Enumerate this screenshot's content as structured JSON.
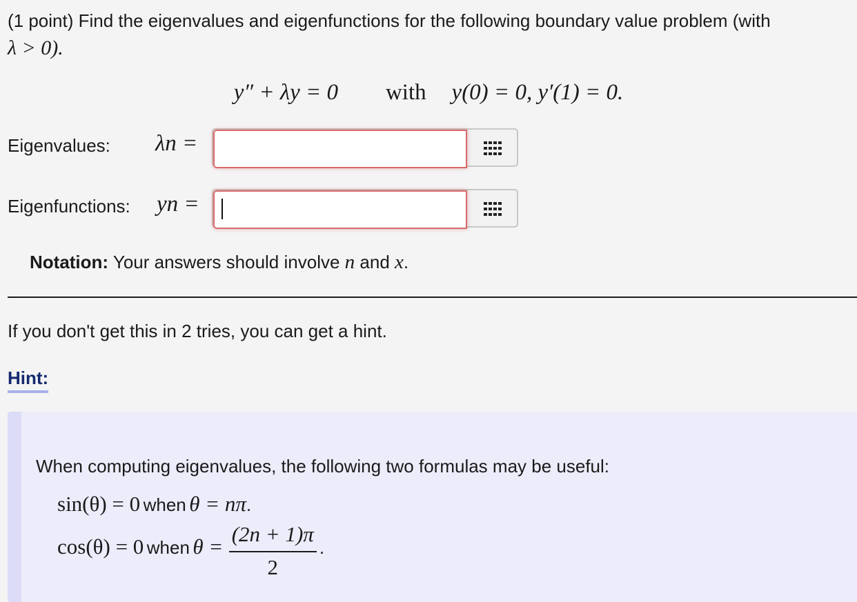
{
  "problem": {
    "prefix": "(1 point) Find the eigenvalues and eigenfunctions for the following boundary value problem (with",
    "condition": "λ > 0).",
    "equation_left": "y″ + λy = 0",
    "equation_with": "with",
    "equation_bc": "y(0) = 0,   y′(1) = 0."
  },
  "eigenvalues": {
    "label": "Eigenvalues:",
    "symbol": "λn =",
    "value": ""
  },
  "eigenfunctions": {
    "label": "Eigenfunctions:",
    "symbol": "yn =",
    "value": ""
  },
  "notation": {
    "bold": "Notation:",
    "text": "Your answers should involve",
    "var1": "n",
    "and": "and",
    "var2": "x",
    "end": "."
  },
  "hint_info": "If you don't get this in 2 tries, you can get a hint.",
  "hint_link": "Hint:",
  "hint": {
    "intro": "When computing eigenvalues, the following two formulas may be useful:",
    "f1_lhs": "sin(θ) = 0",
    "f1_when": "when",
    "f1_rhs": "θ = nπ",
    "f1_end": ".",
    "f2_lhs": "cos(θ) = 0",
    "f2_when": "when",
    "f2_theta": "θ =",
    "f2_num": "(2n + 1)π",
    "f2_den": "2",
    "f2_end": "."
  },
  "icons": {
    "equation_editor": "grid-icon"
  }
}
